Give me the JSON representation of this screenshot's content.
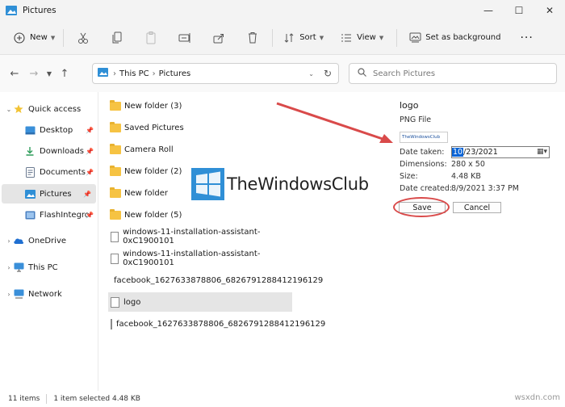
{
  "window": {
    "title": "Pictures",
    "controls": {
      "minimize": "—",
      "maximize": "☐",
      "close": "✕"
    }
  },
  "toolbar": {
    "new_label": "New",
    "sort_label": "Sort",
    "view_label": "View",
    "set_background_label": "Set as background",
    "more_label": "···"
  },
  "nav": {
    "breadcrumbs": [
      "This PC",
      "Pictures"
    ],
    "search_placeholder": "Search Pictures"
  },
  "sidebar": {
    "items": [
      {
        "label": "Quick access",
        "icon": "star-icon"
      },
      {
        "label": "Desktop",
        "icon": "desktop-icon"
      },
      {
        "label": "Downloads",
        "icon": "download-icon"
      },
      {
        "label": "Documents",
        "icon": "document-icon"
      },
      {
        "label": "Pictures",
        "icon": "pictures-icon"
      },
      {
        "label": "FlashIntegro",
        "icon": "folder-icon"
      },
      {
        "label": "OneDrive",
        "icon": "cloud-icon"
      },
      {
        "label": "This PC",
        "icon": "computer-icon"
      },
      {
        "label": "Network",
        "icon": "network-icon"
      }
    ]
  },
  "files": [
    {
      "name": "New folder (3)",
      "type": "folder"
    },
    {
      "name": "Saved Pictures",
      "type": "folder"
    },
    {
      "name": "Camera Roll",
      "type": "folder"
    },
    {
      "name": "New folder (2)",
      "type": "folder"
    },
    {
      "name": "New folder",
      "type": "folder"
    },
    {
      "name": "New folder (5)",
      "type": "folder"
    },
    {
      "name": "windows-11-installation-assistant-0xC1900101",
      "type": "image"
    },
    {
      "name": "windows-11-installation-assistant-0xC1900101",
      "type": "image"
    },
    {
      "name": "facebook_1627633878806_6826791288412196129",
      "type": "edge"
    },
    {
      "name": "logo",
      "type": "image",
      "selected": true
    },
    {
      "name": "facebook_1627633878806_6826791288412196129",
      "type": "image"
    }
  ],
  "logo_overlay": {
    "text": "TheWindowsClub",
    "color": "#2f8fd6"
  },
  "details": {
    "title": "logo",
    "type": "PNG File",
    "thumb_text": "TheWindowsClub",
    "date_taken_label": "Date taken:",
    "date_taken_selected": "10",
    "date_taken_rest": "/23/2021",
    "dimensions_label": "Dimensions:",
    "dimensions": "280 x 50",
    "size_label": "Size:",
    "size": "4.48 KB",
    "date_created_label": "Date created:",
    "date_created": "8/9/2021 3:37 PM",
    "save_label": "Save",
    "cancel_label": "Cancel"
  },
  "status": {
    "items_count": "11 items",
    "selection": "1 item selected  4.48 KB"
  },
  "watermark": "wsxdn.com",
  "colors": {
    "accent": "#0a64d6",
    "annotation": "#d94a4a",
    "folder": "#f6c343"
  }
}
